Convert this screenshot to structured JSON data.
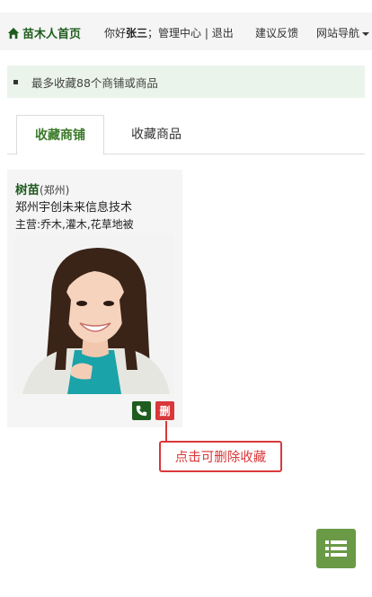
{
  "header": {
    "home_label": "苗木人首页",
    "greeting_prefix": "你好",
    "username": "张三",
    "greeting_sep": "；",
    "admin_link": "管理中心",
    "divider": " | ",
    "logout_link": "退出",
    "feedback_link": "建议反馈",
    "site_nav_label": "网站导航"
  },
  "notice": {
    "text": "最多收藏88个商铺或商品"
  },
  "tabs": [
    {
      "label": "收藏商铺",
      "active": true
    },
    {
      "label": "收藏商品",
      "active": false
    }
  ],
  "shop_card": {
    "name": "树苗",
    "location": "(郑州)",
    "company": "郑州宇创未来信息技术",
    "main_business": "主营:乔木,灌木,花草地被",
    "delete_label": "删"
  },
  "tooltip": {
    "text": "点击可删除收藏"
  },
  "colors": {
    "brand_green": "#1f5c1f",
    "active_tab": "#3a7a2a",
    "danger_red": "#d9383a",
    "menu_button": "#6a9a45",
    "notice_bg": "#eaf4ea"
  },
  "icons": {
    "home": "home-icon",
    "phone": "phone-icon",
    "menu": "list-menu-icon",
    "caret": "caret-down-icon"
  }
}
